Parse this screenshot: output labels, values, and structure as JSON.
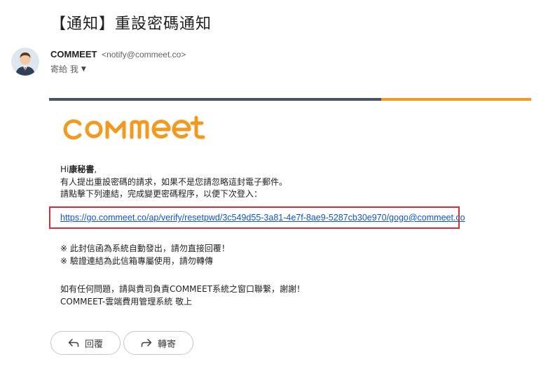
{
  "subject": "【通知】重設密碼通知",
  "sender": {
    "name": "COMMEET",
    "email": "<notify@commeet.co>",
    "recipient_label": "寄給 我"
  },
  "brand": {
    "logo_text": "commeet",
    "bar_colors": {
      "dark": "#4a5560",
      "accent": "#f39a1e"
    }
  },
  "body": {
    "greeting_prefix": "Hi",
    "greeting_name": "康秘書",
    "greeting_suffix": ",",
    "line1": "有人提出重設密碼的請求，如果不是您請忽略這封電子郵件。",
    "line2": "請點擊下列連結，完成變更密碼程序，以便下次登入：",
    "reset_link": "https://go.commeet.co/ap/verify/resetpwd/3c549d55-3a81-4e7f-8ae9-5287cb30e970/gogo@commeet.co",
    "note1": "※ 此封信函為系統自動發出，請勿直接回覆！",
    "note2": "※ 驗證連結為此信箱專屬使用，請勿轉傳",
    "closing1": "如有任何問題，請與貴司負責COMMEET系統之窗口聯繫，謝謝！",
    "closing2": "COMMEET-雲端費用管理系統 敬上"
  },
  "actions": {
    "reply_label": "回覆",
    "forward_label": "轉寄"
  }
}
